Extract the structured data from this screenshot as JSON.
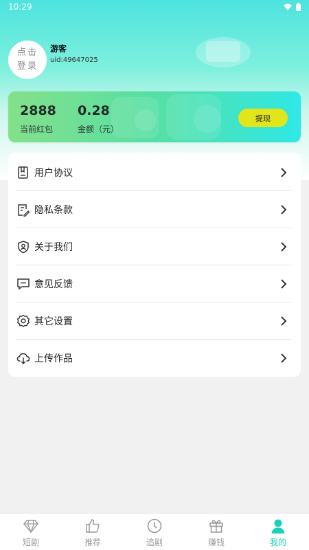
{
  "status_bar": {
    "time": "10:29"
  },
  "profile": {
    "avatar_text": "点击\n登录",
    "name": "游客",
    "uid": "uid:49647025"
  },
  "wallet": {
    "red_packet_value": "2888",
    "red_packet_label": "当前红包",
    "amount_value": "0.28",
    "amount_label": "金额（元）",
    "withdraw_label": "提现",
    "withdraw_color": "#e1e61b"
  },
  "menu": [
    {
      "label": "用户协议",
      "icon": "document-icon"
    },
    {
      "label": "隐私条款",
      "icon": "edit-document-icon"
    },
    {
      "label": "关于我们",
      "icon": "shield-user-icon"
    },
    {
      "label": "意见反馈",
      "icon": "chat-icon"
    },
    {
      "label": "其它设置",
      "icon": "gear-icon"
    },
    {
      "label": "上传作品",
      "icon": "cloud-download-icon"
    }
  ],
  "tabs": [
    {
      "label": "短剧",
      "icon": "diamond-icon",
      "active": false
    },
    {
      "label": "推荐",
      "icon": "thumbs-up-icon",
      "active": false
    },
    {
      "label": "追剧",
      "icon": "clock-icon",
      "active": false
    },
    {
      "label": "赚钱",
      "icon": "gift-icon",
      "active": false
    },
    {
      "label": "我的",
      "icon": "person-icon",
      "active": true
    }
  ],
  "colors": {
    "accent": "#17d2b8",
    "header_teal": "#4de3df"
  }
}
